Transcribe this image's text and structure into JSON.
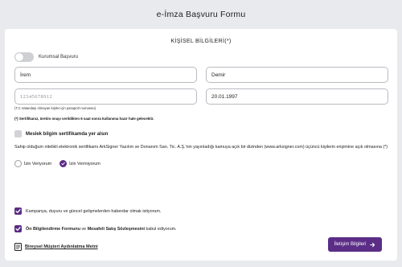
{
  "page": {
    "title": "e-İmza Başvuru Formu"
  },
  "section": {
    "title": "KİŞİSEL BİLGİLERİ(*)"
  },
  "corporate_toggle": {
    "label": "Kurumsal Başvuru",
    "enabled": false
  },
  "fields": {
    "first_name": {
      "value": "İrem"
    },
    "last_name": {
      "value": "Demir"
    },
    "tckn": {
      "placeholder": "12345678912"
    },
    "birth_date": {
      "value": "20.01.1997"
    }
  },
  "hint": "(T.C.Vatandaşı olmayan kişiler için pasaport numarası)",
  "note": "(*) Sertifikanız, üretim onayı verildikten 6 saat sonra kullanıma hazır hale gelecektir.",
  "professional_cert": {
    "label": "Meslek bilgim sertifikamda yer alsın",
    "checked": false
  },
  "consent_text": "Sahip olduğum nitelikli elektronik sertifikamı ArkSigner Yazılım ve Donanım San. Tic. A.Ş.'nin yayınladığı kamuya açık bir dizinden (www.arksigner.com) üçüncü kişilerin erişimine açık olmasına (*)",
  "consent_options": [
    {
      "label": "İzin Veriyorum",
      "selected": false
    },
    {
      "label": "İzin Vermiyorum",
      "selected": true
    }
  ],
  "campaign": {
    "label": "Kampanya, duyuru ve güncel gelişmelerden haberdar olmak istiyorum.",
    "checked": true
  },
  "agreement": {
    "part1": "Ön Bilgilendirme Formunu",
    "part2": " ve ",
    "part3": "Mesafeli Satış Sözleşmesini",
    "part4": " kabul ediyorum.",
    "checked": true
  },
  "privacy_link": {
    "label": "Bireysel Müşteri Aydınlatma Metni",
    "icon": "document-icon"
  },
  "next_button": {
    "label": "İletişim Bilgileri",
    "icon": "arrow-right-icon"
  },
  "colors": {
    "accent": "#5b2d86",
    "background": "#e9eaee",
    "card": "#ffffff"
  }
}
